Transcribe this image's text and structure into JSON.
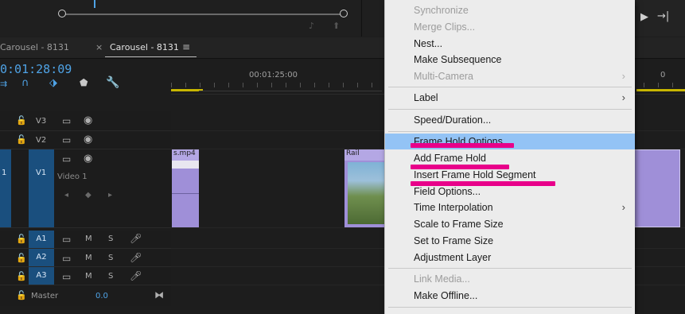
{
  "timeline": {
    "tab_closed": "Carousel - 8131",
    "tab_close_glyph": "×",
    "tab_active": "Carousel - 8131",
    "tab_menu_glyph": "≡",
    "timecode": "0:01:28:09",
    "ruler_label_1": "00:01:25:00",
    "ruler_label_2": "0",
    "tracks": {
      "v3": "V3",
      "v2": "V2",
      "v1": "V1",
      "video1_name": "Video 1",
      "a1": "A1",
      "a2": "A2",
      "a3": "A3",
      "master": "Master",
      "master_value": "0.0",
      "mute": "M",
      "solo": "S"
    },
    "clips": {
      "left_clip_name": "s.mp4",
      "right_clip_name": "Rail"
    },
    "track_left_num": "1",
    "colors": {
      "accent_blue": "#4fa3e6",
      "track_blue": "#1a4f7e",
      "clip_purple": "#9f8fd8",
      "highlight": "#93c3f5",
      "marker_pink": "#e8008a"
    }
  },
  "menu": {
    "synchronize": "Synchronize",
    "merge_clips": "Merge Clips...",
    "nest": "Nest...",
    "make_subsequence": "Make Subsequence",
    "multi_camera": "Multi-Camera",
    "label": "Label",
    "speed_duration": "Speed/Duration...",
    "frame_hold_options": "Frame Hold Options...",
    "add_frame_hold": "Add Frame Hold",
    "insert_frame_hold_segment": "Insert Frame Hold Segment",
    "field_options": "Field Options...",
    "time_interpolation": "Time Interpolation",
    "scale_to_frame_size": "Scale to Frame Size",
    "set_to_frame_size": "Set to Frame Size",
    "adjustment_layer": "Adjustment Layer",
    "link_media": "Link Media...",
    "make_offline": "Make Offline...",
    "submenu_glyph": "›"
  },
  "icons": [
    "scrub-knob",
    "lock-icon",
    "eye-icon",
    "film-icon",
    "mic-icon",
    "wrench-icon",
    "magnet-icon",
    "marker-icon",
    "snap-icon",
    "keyframe-icon",
    "chevron-right-icon"
  ]
}
